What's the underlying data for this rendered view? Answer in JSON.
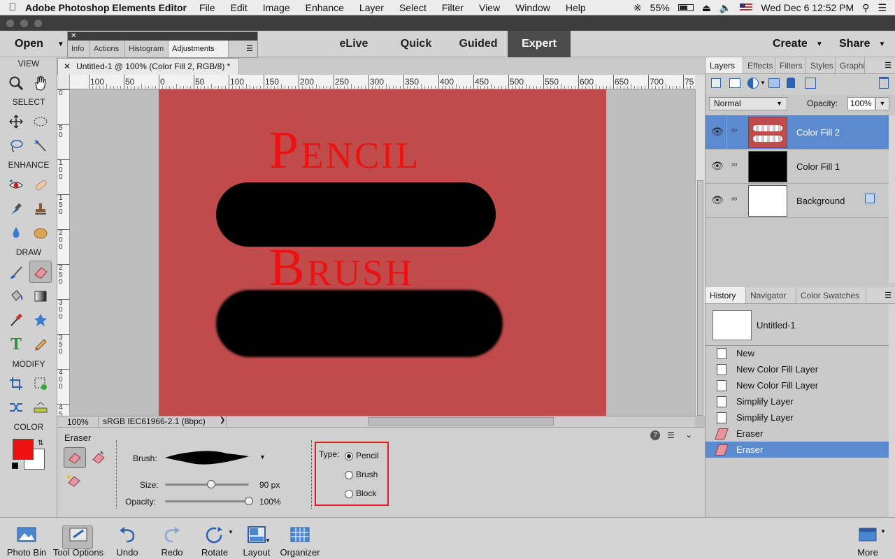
{
  "menubar": {
    "app_name": "Adobe Photoshop Elements Editor",
    "items": [
      "File",
      "Edit",
      "Image",
      "Enhance",
      "Layer",
      "Select",
      "Filter",
      "View",
      "Window",
      "Help"
    ],
    "battery": "55%",
    "datetime": "Wed Dec 6  12:52 PM"
  },
  "topbar": {
    "open_label": "Open",
    "modes": [
      "eLive",
      "Quick",
      "Guided",
      "Expert"
    ],
    "active_mode": "Expert",
    "create_label": "Create",
    "share_label": "Share"
  },
  "float_palette": {
    "tabs": [
      "Info",
      "Actions",
      "Histogram",
      "Adjustments"
    ],
    "active_tab": "Adjustments"
  },
  "toolbox": {
    "sections": {
      "view": "VIEW",
      "select": "SELECT",
      "enhance": "ENHANCE",
      "draw": "DRAW",
      "modify": "MODIFY",
      "color": "COLOR"
    },
    "foreground_color": "#ee1111",
    "background_color": "#ffffff"
  },
  "document": {
    "tab_title": "Untitled-1 @ 100% (Color Fill 2, RGB/8) *",
    "ruler_h": [
      "100",
      "50",
      "0",
      "50",
      "100",
      "150",
      "200",
      "250",
      "300",
      "350",
      "400",
      "450",
      "500",
      "550",
      "600",
      "650",
      "700",
      "75"
    ],
    "ruler_v": [
      "0",
      "5\n0",
      "1\n0\n0",
      "1\n5\n0",
      "2\n0\n0",
      "2\n5\n0",
      "3\n0\n0",
      "3\n5\n0",
      "4\n0\n0",
      "4\n5"
    ],
    "canvas_color": "#bf4b4b",
    "text_pencil": "Pencil",
    "text_brush": "Brush",
    "zoom": "100%",
    "color_profile": "sRGB IEC61966-2.1 (8bpc)"
  },
  "tool_options": {
    "tool_name": "Eraser",
    "brush_label": "Brush:",
    "size_label": "Size:",
    "size_value": "90 px",
    "size_fraction": 0.55,
    "opacity_label": "Opacity:",
    "opacity_value": "100%",
    "opacity_fraction": 1.0,
    "type_label": "Type:",
    "types": [
      "Pencil",
      "Brush",
      "Block"
    ],
    "selected_type": "Pencil",
    "highlight_color": "#e02020"
  },
  "layers_panel": {
    "tabs": [
      "Layers",
      "Effects",
      "Filters",
      "Styles",
      "Graphics"
    ],
    "active_tab": "Layers",
    "blend_mode": "Normal",
    "opacity_label": "Opacity:",
    "opacity_value": "100%",
    "layers": [
      {
        "name": "Color Fill 2",
        "selected": true
      },
      {
        "name": "Color Fill 1",
        "selected": false
      },
      {
        "name": "Background",
        "selected": false
      }
    ]
  },
  "history_panel": {
    "tabs": [
      "History",
      "Navigator",
      "Color Swatches"
    ],
    "active_tab": "History",
    "snapshot": "Untitled-1",
    "items": [
      "New",
      "New Color Fill Layer",
      "New Color Fill Layer",
      "Simplify Layer",
      "Simplify Layer",
      "Eraser",
      "Eraser"
    ],
    "selected_index": 6
  },
  "bottombar": {
    "photo_bin": "Photo Bin",
    "tool_options": "Tool Options",
    "undo": "Undo",
    "redo": "Redo",
    "rotate": "Rotate",
    "layout": "Layout",
    "organizer": "Organizer",
    "more": "More"
  },
  "colors": {
    "selection_blue": "#5b8ad0",
    "accent_red": "#ee1111"
  }
}
